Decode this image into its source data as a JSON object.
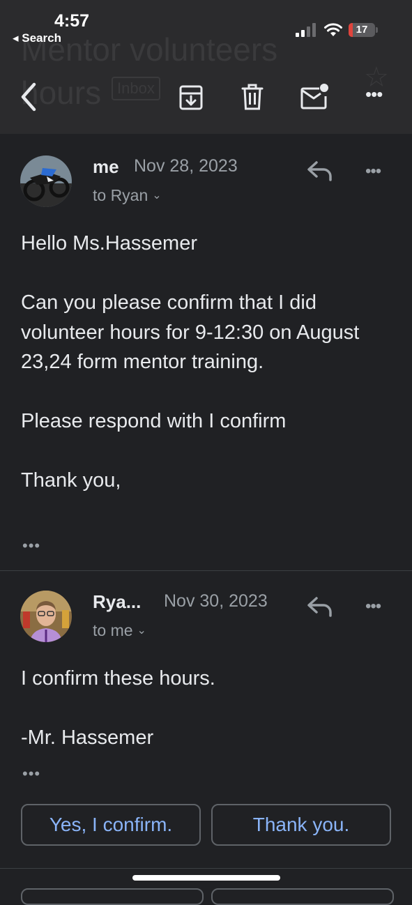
{
  "status_bar": {
    "time": "4:57",
    "back_label": "◂ Search",
    "battery_level": "17",
    "battery_fraction": 0.17
  },
  "header": {
    "subject": "Mentor volunteers\nhours",
    "label_chip": "Inbox",
    "icons": [
      "back-chevron-icon",
      "archive-icon",
      "trash-icon",
      "mark-unread-icon",
      "more-icon"
    ]
  },
  "thread": [
    {
      "sender": "me",
      "date": "Nov 28, 2023",
      "recipient": "to Ryan",
      "body": [
        "Hello Ms.Hassemer",
        "",
        "Can you please confirm that I did volunteer hours for 9-12:30 on August 23,24 form mentor training.",
        "",
        "Please respond with I confirm",
        "",
        "Thank you,"
      ],
      "trimmed": "•••"
    },
    {
      "sender": "Rya...",
      "date": "Nov 30, 2023",
      "recipient": "to me",
      "body": [
        "I confirm these hours.",
        "",
        "-Mr. Hassemer"
      ],
      "trimmed": "•••"
    }
  ],
  "smart_replies": [
    "Yes, I confirm.",
    "Thank you."
  ],
  "colors": {
    "background": "#202124",
    "header": "#2b2b2d",
    "link_blue": "#8ab4f8",
    "battery_red": "#e0443c"
  }
}
